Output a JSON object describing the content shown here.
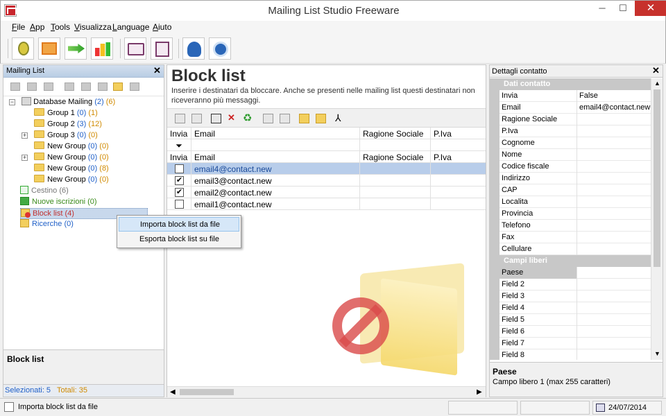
{
  "window": {
    "title": "Mailing List Studio Freeware",
    "minimize": "─",
    "maximize": "☐",
    "close": "✕"
  },
  "menu": [
    {
      "pre": "",
      "u": "F",
      "post": "ile"
    },
    {
      "pre": "",
      "u": "A",
      "post": "pp"
    },
    {
      "pre": "",
      "u": "T",
      "post": "ools"
    },
    {
      "pre": "",
      "u": "V",
      "post": "isualizza"
    },
    {
      "pre": "",
      "u": "L",
      "post": "anguage"
    },
    {
      "pre": "",
      "u": "A",
      "post": "iuto"
    }
  ],
  "toolbar": {
    "icons": [
      "contacts-icon",
      "email-icon",
      "send-icon",
      "stats-icon",
      "open-icon",
      "save-icon",
      "upload-icon",
      "update-icon"
    ]
  },
  "left_panel": {
    "title": "Mailing List",
    "close": "✕",
    "tree": {
      "root": {
        "label": "Database Mailing",
        "count_a": "(2)",
        "count_b": "(6)"
      },
      "groups": [
        {
          "label": "Group 1",
          "count_a": "(0)",
          "count_b": "(1)",
          "expander": ""
        },
        {
          "label": "Group 2",
          "count_a": "(3)",
          "count_b": "(12)",
          "expander": ""
        },
        {
          "label": "Group 3",
          "count_a": "(0)",
          "count_b": "(0)",
          "expander": "+"
        },
        {
          "label": "New Group",
          "count_a": "(0)",
          "count_b": "(0)",
          "expander": ""
        },
        {
          "label": "New Group",
          "count_a": "(0)",
          "count_b": "(0)",
          "expander": "+"
        },
        {
          "label": "New Group",
          "count_a": "(0)",
          "count_b": "(8)",
          "expander": ""
        },
        {
          "label": "New Group",
          "count_a": "(0)",
          "count_b": "(0)",
          "expander": ""
        }
      ],
      "cestino": "Cestino (6)",
      "nuove": "Nuove iscrizioni (0)",
      "blocklist": "Block list (4)",
      "ricerche": "Ricerche (0)"
    },
    "bottom_title": "Block list",
    "status": {
      "selezionati": "Selezionati: 5",
      "totali": "Totali: 35"
    }
  },
  "context_menu": {
    "import": "Importa block list da file",
    "export": "Esporta block list su file"
  },
  "center": {
    "title": "Block list",
    "description": "Inserire i destinatari da bloccare. Anche se presenti nelle mailing list questi destinatari non riceveranno più messaggi.",
    "columns": [
      "Invia",
      "Email",
      "Ragione Sociale",
      "P.Iva"
    ],
    "filter_icon": "filter-icon",
    "rows": [
      {
        "checked": false,
        "email": "email4@contact.new",
        "selected": true
      },
      {
        "checked": true,
        "email": "email3@contact.new",
        "selected": false
      },
      {
        "checked": true,
        "email": "email2@contact.new",
        "selected": false
      },
      {
        "checked": false,
        "email": "email1@contact.new",
        "selected": false
      }
    ]
  },
  "right_panel": {
    "title": "Dettagli contatto",
    "close": "✕",
    "category1": "Dati contatto",
    "fields": [
      {
        "name": "Invia",
        "value": "False"
      },
      {
        "name": "Email",
        "value": "email4@contact.new"
      },
      {
        "name": "Ragione Sociale",
        "value": ""
      },
      {
        "name": "P.Iva",
        "value": ""
      },
      {
        "name": "Cognome",
        "value": ""
      },
      {
        "name": "Nome",
        "value": ""
      },
      {
        "name": "Codice fiscale",
        "value": ""
      },
      {
        "name": "Indirizzo",
        "value": ""
      },
      {
        "name": "CAP",
        "value": ""
      },
      {
        "name": "Localita",
        "value": ""
      },
      {
        "name": "Provincia",
        "value": ""
      },
      {
        "name": "Telefono",
        "value": ""
      },
      {
        "name": "Fax",
        "value": ""
      },
      {
        "name": "Cellulare",
        "value": ""
      }
    ],
    "category2": "Campi liberi",
    "free_fields": [
      {
        "name": "Paese",
        "value": ""
      },
      {
        "name": "Field 2",
        "value": ""
      },
      {
        "name": "Field 3",
        "value": ""
      },
      {
        "name": "Field 4",
        "value": ""
      },
      {
        "name": "Field 5",
        "value": ""
      },
      {
        "name": "Field 6",
        "value": ""
      },
      {
        "name": "Field 7",
        "value": ""
      },
      {
        "name": "Field 8",
        "value": ""
      }
    ],
    "help_title": "Paese",
    "help_desc": "Campo libero 1 (max 255 caratteri)"
  },
  "statusbar": {
    "text": "Importa block list da file",
    "date": "24/07/2014"
  },
  "colors": {
    "accent_blue": "#2060c8",
    "count_orange": "#d08a00",
    "selection": "#b8cdea",
    "close_red": "#c7312c"
  }
}
